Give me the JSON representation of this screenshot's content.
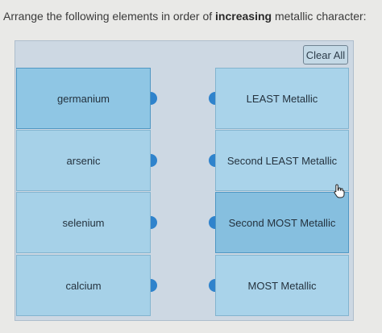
{
  "question": {
    "prefix": "Arrange the following elements in order of ",
    "bold": "increasing",
    "suffix": " metallic character:"
  },
  "clear_all_label": "Clear All",
  "items": [
    {
      "label": "germanium"
    },
    {
      "label": "arsenic"
    },
    {
      "label": "selenium"
    },
    {
      "label": "calcium"
    }
  ],
  "slots": [
    {
      "label": "LEAST Metallic"
    },
    {
      "label": "Second LEAST Metallic"
    },
    {
      "label": "Second MOST Metallic"
    },
    {
      "label": "MOST Metallic"
    }
  ],
  "icons": {
    "cursor": "hand-pointer-icon",
    "connector": "drag-connector-icon"
  },
  "colors": {
    "accent": "#2f83cc",
    "tile": "#a6d1e8",
    "panel": "#cdd8e3"
  }
}
